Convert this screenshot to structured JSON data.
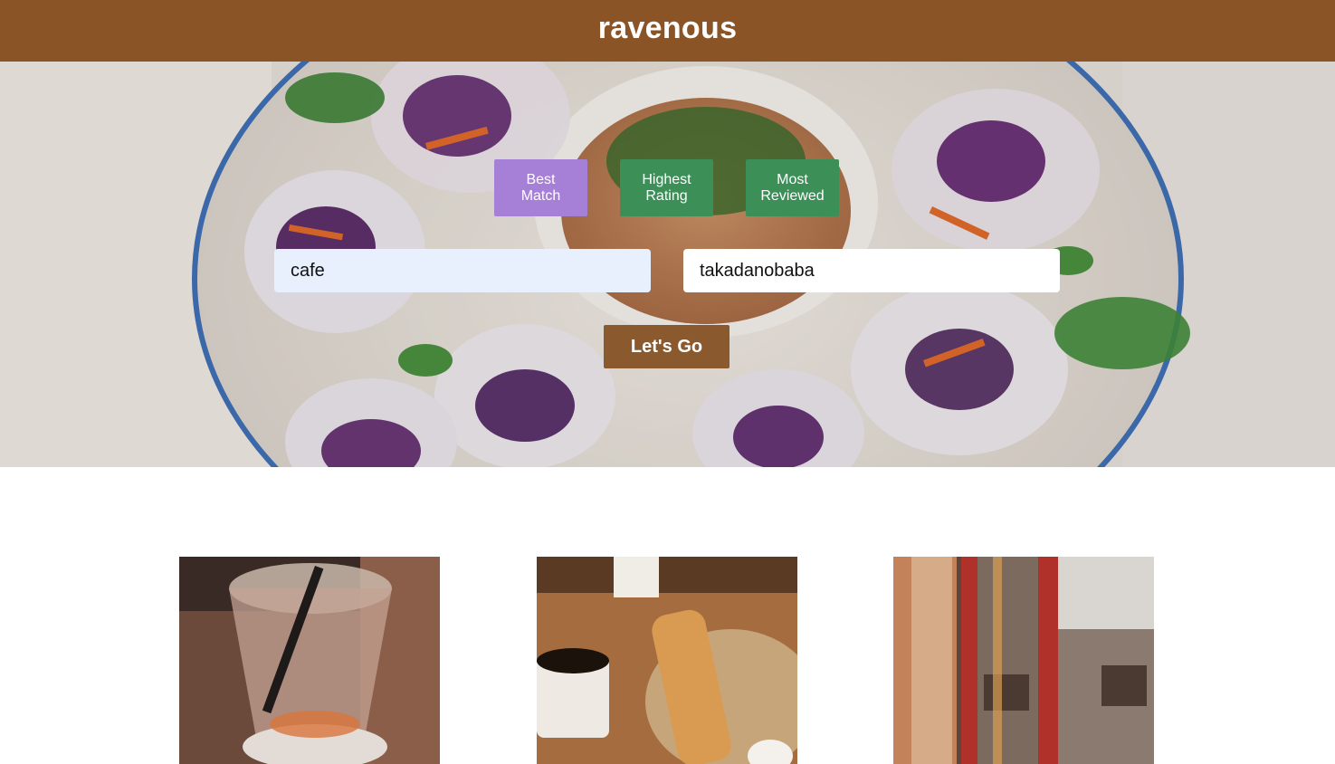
{
  "header": {
    "brand": "ravenous"
  },
  "sort_options": [
    {
      "label_line1": "Best",
      "label_line2": "Match",
      "active": true
    },
    {
      "label_line1": "Highest",
      "label_line2": "Rating",
      "active": false
    },
    {
      "label_line1": "Most",
      "label_line2": "Reviewed",
      "active": false
    }
  ],
  "search": {
    "term_value": "cafe",
    "location_value": "takadanobaba",
    "submit_label": "Let's Go"
  },
  "colors": {
    "header_bg": "#8a5426",
    "active_sort": "#a67fd6",
    "inactive_sort": "#3b8f57",
    "submit_bg": "#8a5a2e"
  }
}
